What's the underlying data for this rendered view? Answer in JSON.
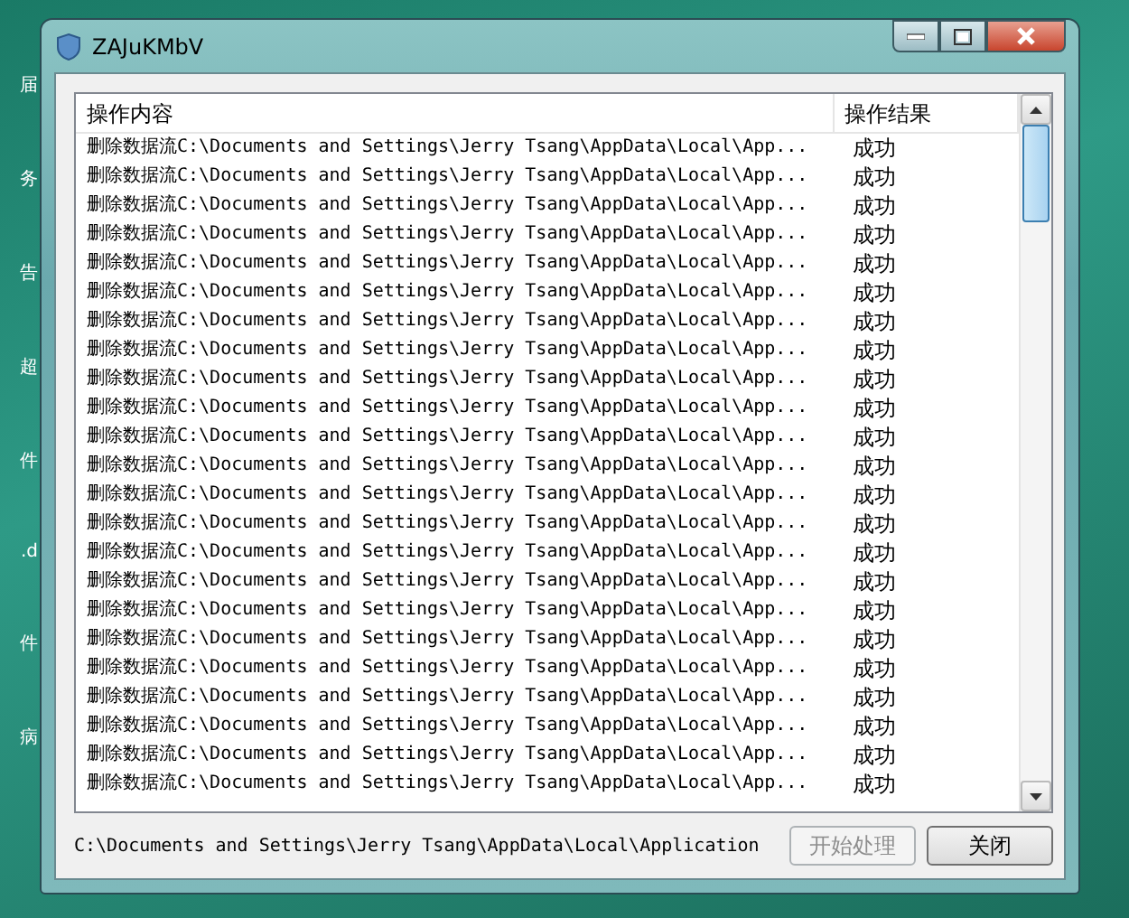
{
  "desktop_icons": [
    {
      "label": "届"
    },
    {
      "label": "务"
    },
    {
      "label": "告"
    },
    {
      "label": "超"
    },
    {
      "label": "件"
    },
    {
      "label": ".d"
    },
    {
      "label": "件"
    },
    {
      "label": "病"
    }
  ],
  "window": {
    "title": "ZAJuKMbV"
  },
  "table": {
    "columns": [
      "操作内容",
      "操作结果"
    ],
    "rows": [
      {
        "action": "删除数据流C:\\Documents and Settings\\Jerry Tsang\\AppData\\Local\\App...",
        "result": "成功"
      },
      {
        "action": "删除数据流C:\\Documents and Settings\\Jerry Tsang\\AppData\\Local\\App...",
        "result": "成功"
      },
      {
        "action": "删除数据流C:\\Documents and Settings\\Jerry Tsang\\AppData\\Local\\App...",
        "result": "成功"
      },
      {
        "action": "删除数据流C:\\Documents and Settings\\Jerry Tsang\\AppData\\Local\\App...",
        "result": "成功"
      },
      {
        "action": "删除数据流C:\\Documents and Settings\\Jerry Tsang\\AppData\\Local\\App...",
        "result": "成功"
      },
      {
        "action": "删除数据流C:\\Documents and Settings\\Jerry Tsang\\AppData\\Local\\App...",
        "result": "成功"
      },
      {
        "action": "删除数据流C:\\Documents and Settings\\Jerry Tsang\\AppData\\Local\\App...",
        "result": "成功"
      },
      {
        "action": "删除数据流C:\\Documents and Settings\\Jerry Tsang\\AppData\\Local\\App...",
        "result": "成功"
      },
      {
        "action": "删除数据流C:\\Documents and Settings\\Jerry Tsang\\AppData\\Local\\App...",
        "result": "成功"
      },
      {
        "action": "删除数据流C:\\Documents and Settings\\Jerry Tsang\\AppData\\Local\\App...",
        "result": "成功"
      },
      {
        "action": "删除数据流C:\\Documents and Settings\\Jerry Tsang\\AppData\\Local\\App...",
        "result": "成功"
      },
      {
        "action": "删除数据流C:\\Documents and Settings\\Jerry Tsang\\AppData\\Local\\App...",
        "result": "成功"
      },
      {
        "action": "删除数据流C:\\Documents and Settings\\Jerry Tsang\\AppData\\Local\\App...",
        "result": "成功"
      },
      {
        "action": "删除数据流C:\\Documents and Settings\\Jerry Tsang\\AppData\\Local\\App...",
        "result": "成功"
      },
      {
        "action": "删除数据流C:\\Documents and Settings\\Jerry Tsang\\AppData\\Local\\App...",
        "result": "成功"
      },
      {
        "action": "删除数据流C:\\Documents and Settings\\Jerry Tsang\\AppData\\Local\\App...",
        "result": "成功"
      },
      {
        "action": "删除数据流C:\\Documents and Settings\\Jerry Tsang\\AppData\\Local\\App...",
        "result": "成功"
      },
      {
        "action": "删除数据流C:\\Documents and Settings\\Jerry Tsang\\AppData\\Local\\App...",
        "result": "成功"
      },
      {
        "action": "删除数据流C:\\Documents and Settings\\Jerry Tsang\\AppData\\Local\\App...",
        "result": "成功"
      },
      {
        "action": "删除数据流C:\\Documents and Settings\\Jerry Tsang\\AppData\\Local\\App...",
        "result": "成功"
      },
      {
        "action": "删除数据流C:\\Documents and Settings\\Jerry Tsang\\AppData\\Local\\App...",
        "result": "成功"
      },
      {
        "action": "删除数据流C:\\Documents and Settings\\Jerry Tsang\\AppData\\Local\\App...",
        "result": "成功"
      },
      {
        "action": "删除数据流C:\\Documents and Settings\\Jerry Tsang\\AppData\\Local\\App...",
        "result": "成功"
      }
    ]
  },
  "status_path": "C:\\Documents and Settings\\Jerry Tsang\\AppData\\Local\\Application",
  "buttons": [
    {
      "label": "开始处理",
      "disabled": true
    },
    {
      "label": "关闭",
      "disabled": false
    }
  ]
}
